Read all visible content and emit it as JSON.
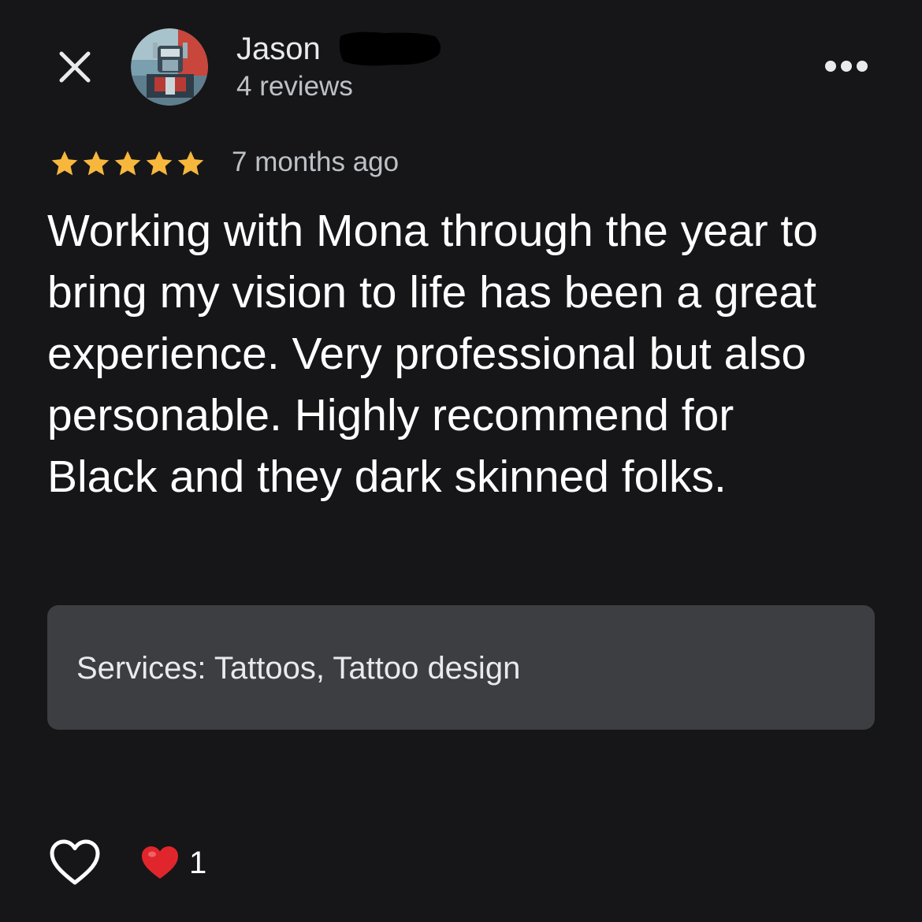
{
  "header": {
    "close_icon": "close-icon",
    "reviewer_name": "Jason",
    "review_count": "4 reviews",
    "more_icon": "more-horizontal-icon"
  },
  "review": {
    "rating": 5,
    "max_rating": 5,
    "star_color": "#f6b73c",
    "time_ago": "7 months ago",
    "text": "Working with Mona through the year to bring my vision to life has been a great experience. Very professional but also personable. Highly recommend for Black and they dark skinned folks."
  },
  "services": {
    "label": "Services:",
    "value": "Tattoos, Tattoo design"
  },
  "footer": {
    "like_icon": "heart-outline-icon",
    "reaction_icon": "red-heart-icon",
    "reaction_count": "1"
  },
  "colors": {
    "background": "#161618",
    "text_primary": "#ffffff",
    "text_secondary": "#bdc1c6",
    "services_bg": "#3c3e41",
    "heart_red": "#e0262c"
  }
}
